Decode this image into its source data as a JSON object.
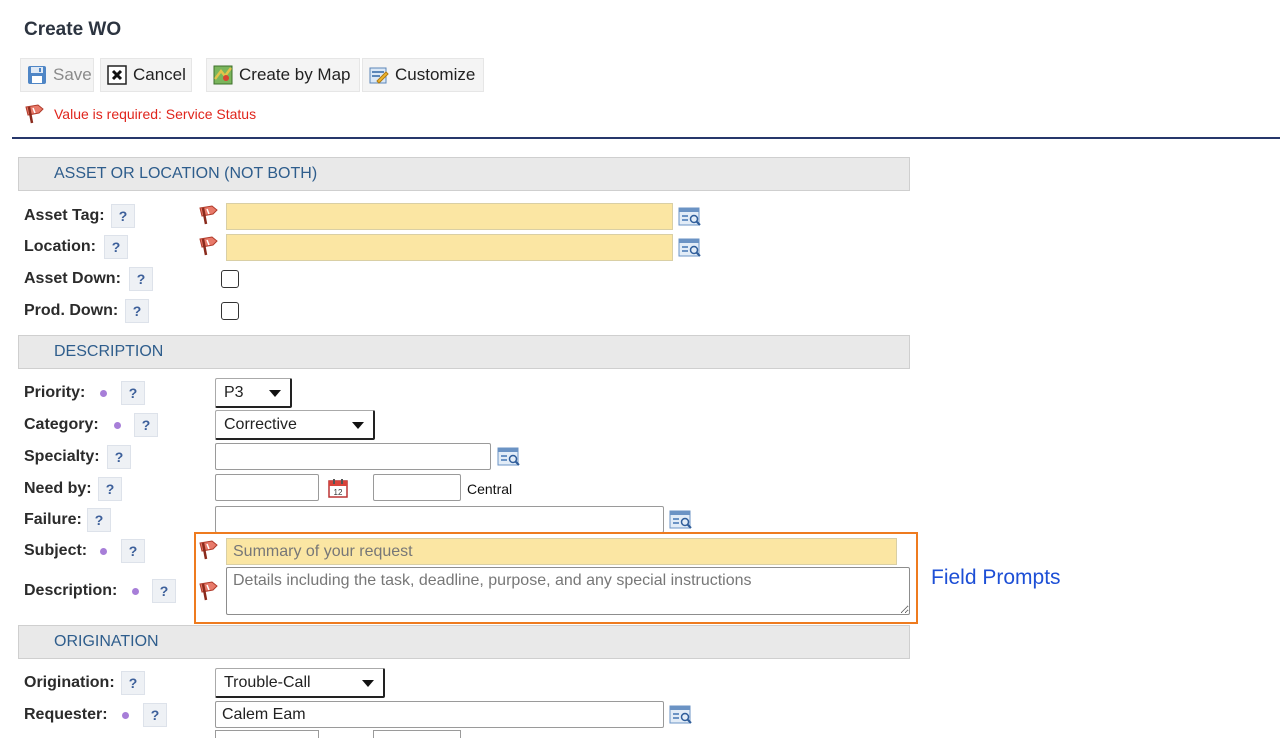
{
  "header": {
    "title": "Create WO"
  },
  "toolbar": {
    "save_label": "Save",
    "cancel_label": "Cancel",
    "create_by_map_label": "Create by Map",
    "customize_label": "Customize"
  },
  "error": {
    "message": "Value is required: Service Status"
  },
  "help_glyph": "?",
  "sections": {
    "asset": "ASSET OR LOCATION (NOT BOTH)",
    "description": "DESCRIPTION",
    "origination": "ORIGINATION"
  },
  "fields": {
    "asset_tag": {
      "label": "Asset Tag:",
      "value": ""
    },
    "location": {
      "label": "Location:",
      "value": ""
    },
    "asset_down": {
      "label": "Asset Down:",
      "checked": false
    },
    "prod_down": {
      "label": "Prod. Down:",
      "checked": false
    },
    "priority": {
      "label": "Priority:",
      "selected": "P3"
    },
    "category": {
      "label": "Category:",
      "selected": "Corrective"
    },
    "specialty": {
      "label": "Specialty:",
      "value": ""
    },
    "need_by": {
      "label": "Need by:",
      "date": "",
      "time": "",
      "timezone": "Central"
    },
    "failure": {
      "label": "Failure:",
      "value": ""
    },
    "subject": {
      "label": "Subject:",
      "placeholder": "Summary of your request"
    },
    "description": {
      "label": "Description:",
      "placeholder": "Details including the task, deadline, purpose, and any special instructions"
    },
    "origination": {
      "label": "Origination:",
      "selected": "Trouble-Call"
    },
    "requester": {
      "label": "Requester:",
      "value": "Calem Eam"
    }
  },
  "annotation": {
    "text": "Field Prompts",
    "color": "#1d4fd6",
    "box_color": "#ee7b1f"
  },
  "colors": {
    "required_fill": "#fbe6a3",
    "error_text": "#e0251c",
    "section_text": "#2e5d8c",
    "required_dot": "#a77ed8"
  },
  "icons": [
    "save-icon",
    "cancel-icon",
    "map-icon",
    "customize-icon",
    "required-flag-icon",
    "lookup-icon",
    "calendar-icon",
    "help-icon"
  ]
}
